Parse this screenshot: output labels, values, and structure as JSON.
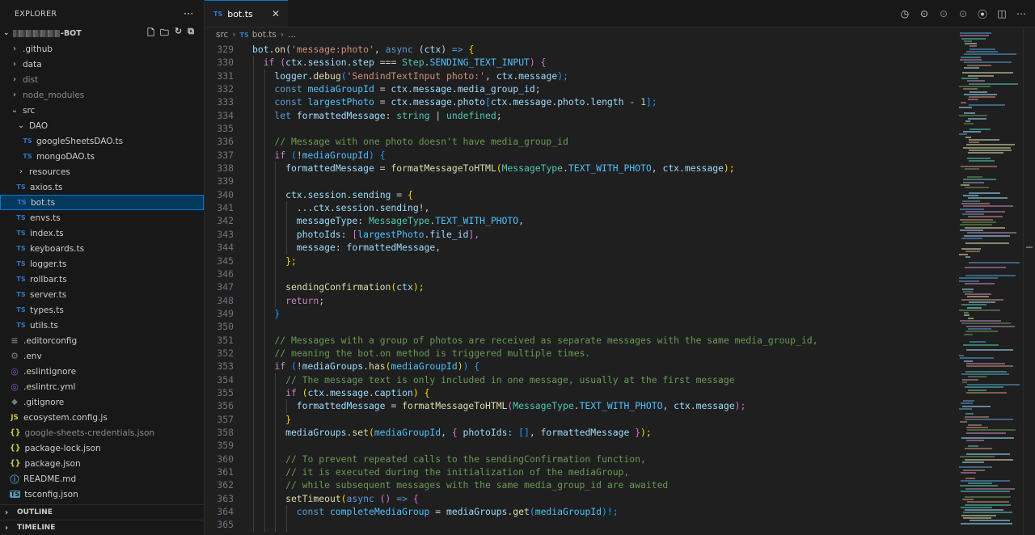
{
  "explorer": {
    "title": "EXPLORER",
    "more_icon": "ellipsis-icon",
    "project_name": "-BOT",
    "actions": [
      "new-file-icon",
      "new-folder-icon",
      "refresh-icon",
      "collapse-all-icon"
    ]
  },
  "tree": [
    {
      "label": ".github",
      "type": "folder",
      "depth": 0,
      "open": false
    },
    {
      "label": "data",
      "type": "folder",
      "depth": 0,
      "open": false
    },
    {
      "label": "dist",
      "type": "folder",
      "depth": 0,
      "open": false,
      "dim": true
    },
    {
      "label": "node_modules",
      "type": "folder",
      "depth": 0,
      "open": false,
      "dim": true
    },
    {
      "label": "src",
      "type": "folder",
      "depth": 0,
      "open": true
    },
    {
      "label": "DAO",
      "type": "folder",
      "depth": 1,
      "open": true
    },
    {
      "label": "googleSheetsDAO.ts",
      "type": "ts",
      "depth": 2
    },
    {
      "label": "mongoDAO.ts",
      "type": "ts",
      "depth": 2
    },
    {
      "label": "resources",
      "type": "folder",
      "depth": 1,
      "open": false
    },
    {
      "label": "axios.ts",
      "type": "ts",
      "depth": 1
    },
    {
      "label": "bot.ts",
      "type": "ts",
      "depth": 1,
      "selected": true
    },
    {
      "label": "envs.ts",
      "type": "ts",
      "depth": 1
    },
    {
      "label": "index.ts",
      "type": "ts",
      "depth": 1
    },
    {
      "label": "keyboards.ts",
      "type": "ts",
      "depth": 1
    },
    {
      "label": "logger.ts",
      "type": "ts",
      "depth": 1
    },
    {
      "label": "rollbar.ts",
      "type": "ts",
      "depth": 1
    },
    {
      "label": "server.ts",
      "type": "ts",
      "depth": 1
    },
    {
      "label": "types.ts",
      "type": "ts",
      "depth": 1
    },
    {
      "label": "utils.ts",
      "type": "ts",
      "depth": 1
    },
    {
      "label": ".editorconfig",
      "type": "lines",
      "depth": 0
    },
    {
      "label": ".env",
      "type": "gear",
      "depth": 0
    },
    {
      "label": ".eslintignore",
      "type": "eslint",
      "depth": 0
    },
    {
      "label": ".eslintrc.yml",
      "type": "eslint",
      "depth": 0
    },
    {
      "label": ".gitignore",
      "type": "git",
      "depth": 0
    },
    {
      "label": "ecosystem.config.js",
      "type": "js",
      "depth": 0
    },
    {
      "label": "google-sheets-credentials.json",
      "type": "json",
      "depth": 0,
      "dim": true
    },
    {
      "label": "package-lock.json",
      "type": "json",
      "depth": 0
    },
    {
      "label": "package.json",
      "type": "json",
      "depth": 0
    },
    {
      "label": "README.md",
      "type": "info",
      "depth": 0
    },
    {
      "label": "tsconfig.json",
      "type": "tsc",
      "depth": 0
    }
  ],
  "panels": {
    "outline": "OUTLINE",
    "timeline": "TIMELINE"
  },
  "tab": {
    "label": "bot.ts",
    "badge": "TS",
    "close_icon": "close-icon"
  },
  "editor_actions": [
    "history-icon",
    "go-back-icon",
    "go-forward-icon",
    "go-forward-alt-icon",
    "gitlens-icon",
    "split-editor-icon",
    "more-actions-icon"
  ],
  "breadcrumb": {
    "folder": "src",
    "file": "bot.ts",
    "badge": "TS",
    "tail": "..."
  },
  "code": [
    {
      "n": "329",
      "indent": 0,
      "t": [
        [
          "bot",
          "var"
        ],
        [
          ".",
          "p"
        ],
        [
          "on",
          "fn"
        ],
        [
          "(",
          "p"
        ],
        [
          "'message:photo'",
          "str"
        ],
        [
          ", ",
          "p"
        ],
        [
          "async",
          "kw"
        ],
        [
          " (",
          "p"
        ],
        [
          "ctx",
          "var"
        ],
        [
          ") ",
          "p"
        ],
        [
          "=>",
          "kw"
        ],
        [
          " {",
          "br1"
        ]
      ]
    },
    {
      "n": "330",
      "indent": 1,
      "t": [
        [
          "if",
          "ctl"
        ],
        [
          " (",
          "br2"
        ],
        [
          "ctx",
          "var"
        ],
        [
          ".",
          "p"
        ],
        [
          "session",
          "var"
        ],
        [
          ".",
          "p"
        ],
        [
          "step",
          "var"
        ],
        [
          " === ",
          "p"
        ],
        [
          "Step",
          "type"
        ],
        [
          ".",
          "p"
        ],
        [
          "SENDING_TEXT_INPUT",
          "const"
        ],
        [
          ") {",
          "br2"
        ]
      ]
    },
    {
      "n": "331",
      "indent": 2,
      "t": [
        [
          "logger",
          "var"
        ],
        [
          ".",
          "p"
        ],
        [
          "debug",
          "fn"
        ],
        [
          "(",
          "br3"
        ],
        [
          "'SendindTextInput photo:'",
          "str"
        ],
        [
          ", ",
          "p"
        ],
        [
          "ctx",
          "var"
        ],
        [
          ".",
          "p"
        ],
        [
          "message",
          "var"
        ],
        [
          ");",
          "br3"
        ]
      ]
    },
    {
      "n": "332",
      "indent": 2,
      "t": [
        [
          "const",
          "kw"
        ],
        [
          " ",
          "p"
        ],
        [
          "mediaGroupId",
          "const"
        ],
        [
          " = ",
          "p"
        ],
        [
          "ctx",
          "var"
        ],
        [
          ".",
          "p"
        ],
        [
          "message",
          "var"
        ],
        [
          ".",
          "p"
        ],
        [
          "media_group_id",
          "var"
        ],
        [
          ";",
          "p"
        ]
      ]
    },
    {
      "n": "333",
      "indent": 2,
      "t": [
        [
          "const",
          "kw"
        ],
        [
          " ",
          "p"
        ],
        [
          "largestPhoto",
          "const"
        ],
        [
          " = ",
          "p"
        ],
        [
          "ctx",
          "var"
        ],
        [
          ".",
          "p"
        ],
        [
          "message",
          "var"
        ],
        [
          ".",
          "p"
        ],
        [
          "photo",
          "var"
        ],
        [
          "[",
          "br3"
        ],
        [
          "ctx",
          "var"
        ],
        [
          ".",
          "p"
        ],
        [
          "message",
          "var"
        ],
        [
          ".",
          "p"
        ],
        [
          "photo",
          "var"
        ],
        [
          ".",
          "p"
        ],
        [
          "length",
          "var"
        ],
        [
          " - ",
          "p"
        ],
        [
          "1",
          "num"
        ],
        [
          "];",
          "br3"
        ]
      ]
    },
    {
      "n": "334",
      "indent": 2,
      "t": [
        [
          "let",
          "kw"
        ],
        [
          " ",
          "p"
        ],
        [
          "formattedMessage",
          "var"
        ],
        [
          ": ",
          "p"
        ],
        [
          "string",
          "type"
        ],
        [
          " | ",
          "p"
        ],
        [
          "undefined",
          "type"
        ],
        [
          ";",
          "p"
        ]
      ]
    },
    {
      "n": "335",
      "indent": 2,
      "t": []
    },
    {
      "n": "336",
      "indent": 2,
      "t": [
        [
          "// Message with one photo doesn't have media_group_id",
          "cmt"
        ]
      ]
    },
    {
      "n": "337",
      "indent": 2,
      "t": [
        [
          "if",
          "ctl"
        ],
        [
          " (",
          "br3"
        ],
        [
          "!",
          "p"
        ],
        [
          "mediaGroupId",
          "const"
        ],
        [
          ") {",
          "br3"
        ]
      ]
    },
    {
      "n": "338",
      "indent": 3,
      "t": [
        [
          "formattedMessage",
          "var"
        ],
        [
          " = ",
          "p"
        ],
        [
          "formatMessageToHTML",
          "fn"
        ],
        [
          "(",
          "br1"
        ],
        [
          "MessageType",
          "type"
        ],
        [
          ".",
          "p"
        ],
        [
          "TEXT_WITH_PHOTO",
          "const"
        ],
        [
          ", ",
          "p"
        ],
        [
          "ctx",
          "var"
        ],
        [
          ".",
          "p"
        ],
        [
          "message",
          "var"
        ],
        [
          ");",
          "br1"
        ]
      ]
    },
    {
      "n": "339",
      "indent": 3,
      "t": []
    },
    {
      "n": "340",
      "indent": 3,
      "t": [
        [
          "ctx",
          "var"
        ],
        [
          ".",
          "p"
        ],
        [
          "session",
          "var"
        ],
        [
          ".",
          "p"
        ],
        [
          "sending",
          "var"
        ],
        [
          " = ",
          "p"
        ],
        [
          "{",
          "br1"
        ]
      ]
    },
    {
      "n": "341",
      "indent": 4,
      "t": [
        [
          "...",
          "p"
        ],
        [
          "ctx",
          "var"
        ],
        [
          ".",
          "p"
        ],
        [
          "session",
          "var"
        ],
        [
          ".",
          "p"
        ],
        [
          "sending",
          "var"
        ],
        [
          "!,",
          "p"
        ]
      ]
    },
    {
      "n": "342",
      "indent": 4,
      "t": [
        [
          "messageType",
          "var"
        ],
        [
          ": ",
          "p"
        ],
        [
          "MessageType",
          "type"
        ],
        [
          ".",
          "p"
        ],
        [
          "TEXT_WITH_PHOTO",
          "const"
        ],
        [
          ",",
          "p"
        ]
      ]
    },
    {
      "n": "343",
      "indent": 4,
      "t": [
        [
          "photoIds",
          "var"
        ],
        [
          ": ",
          "p"
        ],
        [
          "[",
          "br2"
        ],
        [
          "largestPhoto",
          "const"
        ],
        [
          ".",
          "p"
        ],
        [
          "file_id",
          "var"
        ],
        [
          "],",
          "br2"
        ]
      ]
    },
    {
      "n": "344",
      "indent": 4,
      "t": [
        [
          "message",
          "var"
        ],
        [
          ": ",
          "p"
        ],
        [
          "formattedMessage",
          "var"
        ],
        [
          ",",
          "p"
        ]
      ]
    },
    {
      "n": "345",
      "indent": 3,
      "t": [
        [
          "};",
          "br1"
        ]
      ]
    },
    {
      "n": "346",
      "indent": 3,
      "t": []
    },
    {
      "n": "347",
      "indent": 3,
      "t": [
        [
          "sendingConfirmation",
          "fn"
        ],
        [
          "(",
          "br1"
        ],
        [
          "ctx",
          "var"
        ],
        [
          ");",
          "br1"
        ]
      ]
    },
    {
      "n": "348",
      "indent": 3,
      "t": [
        [
          "return",
          "ctl"
        ],
        [
          ";",
          "p"
        ]
      ]
    },
    {
      "n": "349",
      "indent": 2,
      "t": [
        [
          "}",
          "br3"
        ]
      ]
    },
    {
      "n": "350",
      "indent": 2,
      "t": []
    },
    {
      "n": "351",
      "indent": 2,
      "t": [
        [
          "// Messages with a group of photos are received as separate messages with the same media_group_id,",
          "cmt"
        ]
      ]
    },
    {
      "n": "352",
      "indent": 2,
      "t": [
        [
          "// meaning the bot.on method is triggered multiple times.",
          "cmt"
        ]
      ]
    },
    {
      "n": "353",
      "indent": 2,
      "t": [
        [
          "if",
          "ctl"
        ],
        [
          " (",
          "br3"
        ],
        [
          "!",
          "p"
        ],
        [
          "mediaGroups",
          "var"
        ],
        [
          ".",
          "p"
        ],
        [
          "has",
          "fn"
        ],
        [
          "(",
          "br1"
        ],
        [
          "mediaGroupId",
          "const"
        ],
        [
          ")",
          "br1"
        ],
        [
          ") {",
          "br3"
        ]
      ]
    },
    {
      "n": "354",
      "indent": 3,
      "t": [
        [
          "// The message text is only included in one message, usually at the first message",
          "cmt"
        ]
      ]
    },
    {
      "n": "355",
      "indent": 3,
      "t": [
        [
          "if",
          "ctl"
        ],
        [
          " (",
          "br1"
        ],
        [
          "ctx",
          "var"
        ],
        [
          ".",
          "p"
        ],
        [
          "message",
          "var"
        ],
        [
          ".",
          "p"
        ],
        [
          "caption",
          "var"
        ],
        [
          ") {",
          "br1"
        ]
      ]
    },
    {
      "n": "356",
      "indent": 4,
      "t": [
        [
          "formattedMessage",
          "var"
        ],
        [
          " = ",
          "p"
        ],
        [
          "formatMessageToHTML",
          "fn"
        ],
        [
          "(",
          "br2"
        ],
        [
          "MessageType",
          "type"
        ],
        [
          ".",
          "p"
        ],
        [
          "TEXT_WITH_PHOTO",
          "const"
        ],
        [
          ", ",
          "p"
        ],
        [
          "ctx",
          "var"
        ],
        [
          ".",
          "p"
        ],
        [
          "message",
          "var"
        ],
        [
          ");",
          "br2"
        ]
      ]
    },
    {
      "n": "357",
      "indent": 3,
      "t": [
        [
          "}",
          "br1"
        ]
      ]
    },
    {
      "n": "358",
      "indent": 3,
      "t": [
        [
          "mediaGroups",
          "var"
        ],
        [
          ".",
          "p"
        ],
        [
          "set",
          "fn"
        ],
        [
          "(",
          "br1"
        ],
        [
          "mediaGroupId",
          "const"
        ],
        [
          ", ",
          "p"
        ],
        [
          "{",
          "br2"
        ],
        [
          " photoIds: ",
          "var"
        ],
        [
          "[]",
          "br3"
        ],
        [
          ", ",
          "p"
        ],
        [
          "formattedMessage",
          "var"
        ],
        [
          " }",
          "br2"
        ],
        [
          ");",
          "br1"
        ]
      ]
    },
    {
      "n": "359",
      "indent": 3,
      "t": []
    },
    {
      "n": "360",
      "indent": 3,
      "t": [
        [
          "// To prevent repeated calls to the sendingConfirmation function,",
          "cmt"
        ]
      ]
    },
    {
      "n": "361",
      "indent": 3,
      "t": [
        [
          "// it is executed during the initialization of the mediaGroup,",
          "cmt"
        ]
      ]
    },
    {
      "n": "362",
      "indent": 3,
      "t": [
        [
          "// while subsequent messages with the same media_group_id are awaited",
          "cmt"
        ]
      ]
    },
    {
      "n": "363",
      "indent": 3,
      "t": [
        [
          "setTimeout",
          "fn"
        ],
        [
          "(",
          "br1"
        ],
        [
          "async",
          "kw"
        ],
        [
          " () ",
          "br2"
        ],
        [
          "=>",
          "kw"
        ],
        [
          " {",
          "br2"
        ]
      ]
    },
    {
      "n": "364",
      "indent": 4,
      "t": [
        [
          "const",
          "kw"
        ],
        [
          " ",
          "p"
        ],
        [
          "completeMediaGroup",
          "const"
        ],
        [
          " = ",
          "p"
        ],
        [
          "mediaGroups",
          "var"
        ],
        [
          ".",
          "p"
        ],
        [
          "get",
          "fn"
        ],
        [
          "(",
          "br3"
        ],
        [
          "mediaGroupId",
          "const"
        ],
        [
          ")!;",
          "br3"
        ]
      ]
    },
    {
      "n": "365",
      "indent": 4,
      "t": []
    }
  ],
  "colors": {
    "kw": "#569cd6",
    "ctl": "#c586c0",
    "fn": "#dcdcaa",
    "var": "#9cdcfe",
    "const": "#4fc1ff",
    "type": "#4ec9b0",
    "str": "#ce9178",
    "num": "#b5cea8",
    "cmt": "#6a9955",
    "p": "#cccccc",
    "br1": "#ffd700",
    "br2": "#da70d6",
    "br3": "#179fff"
  }
}
